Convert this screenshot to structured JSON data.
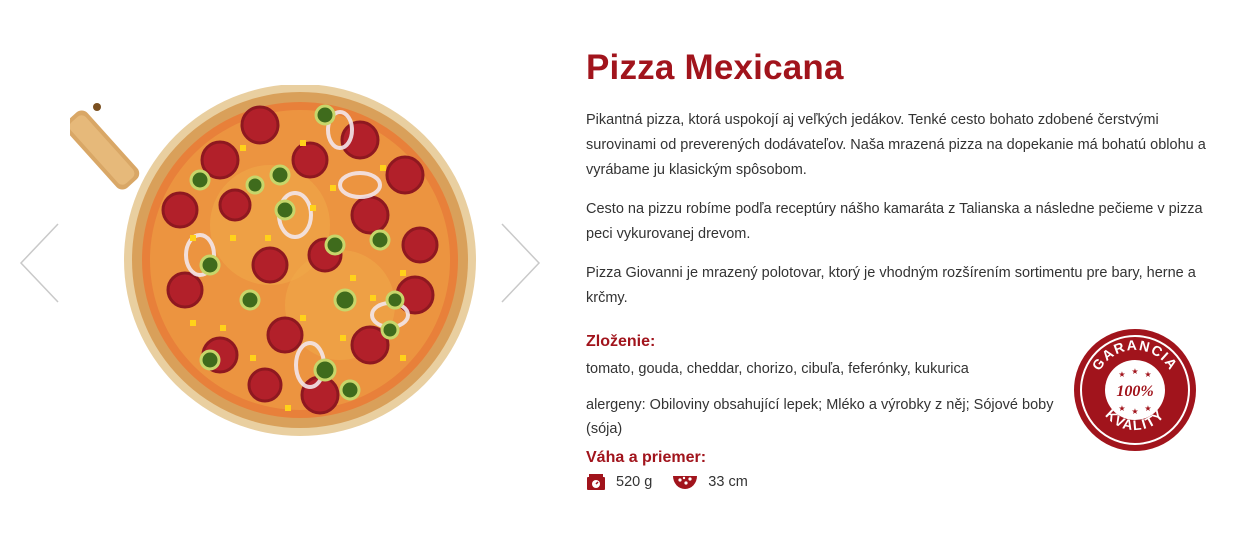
{
  "product": {
    "title": "Pizza Mexicana",
    "description": [
      "Pikantná pizza, ktorá uspokojí aj veľkých jedákov. Tenké cesto bohato zdobené čerstvými surovinami od preverených dodávateľov. Naša mrazená pizza na dopekanie má bohatú oblohu a vyrábame ju klasickým spôsobom.",
      "Cesto na pizzu robíme podľa receptúry nášho kamaráta z Talianska a následne pečieme v pizza peci vykurovanej drevom.",
      "Pizza Giovanni je mrazený polotovar, ktorý je vhodným rozšírením sortimentu pre bary, herne a krčmy."
    ],
    "composition_heading": "Zloženie:",
    "ingredients": "tomato, gouda, cheddar, chorizo, cibuľa, feferónky, kukurica",
    "allergens": "alergeny: Obiloviny obsahující lepek; Mléko a výrobky z něj; Sójové boby (sója)",
    "weight_heading": "Váha a priemer:",
    "weight": "520 g",
    "diameter": "33 cm"
  },
  "badge": {
    "top_text": "GARANCIA",
    "center_text": "100%",
    "bottom_text": "KVALITY"
  },
  "colors": {
    "accent": "#a1141c",
    "text": "#333333"
  },
  "icons": {
    "prev": "chevron-left-icon",
    "next": "chevron-right-icon",
    "weight": "scale-icon",
    "diameter": "pizza-slice-icon"
  }
}
